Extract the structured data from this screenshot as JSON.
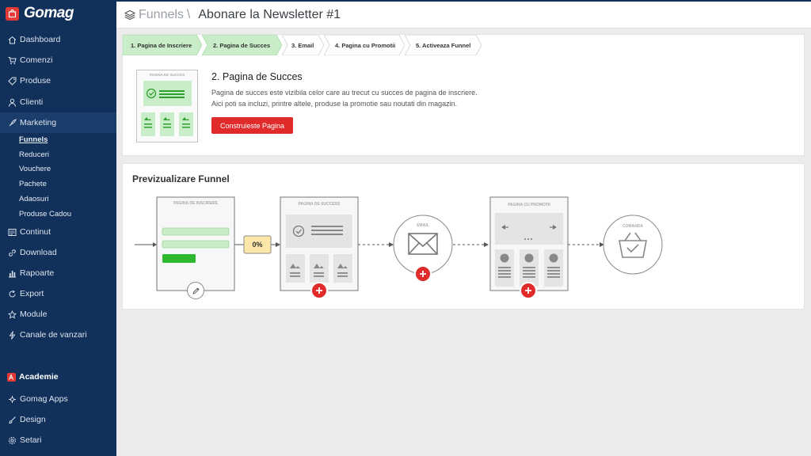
{
  "brand": {
    "name": "Gomag"
  },
  "sidebar": {
    "items": [
      {
        "label": "Dashboard",
        "icon": "home-icon"
      },
      {
        "label": "Comenzi",
        "icon": "cart-icon"
      },
      {
        "label": "Produse",
        "icon": "tag-icon"
      },
      {
        "label": "Clienti",
        "icon": "users-icon"
      },
      {
        "label": "Marketing",
        "icon": "rocket-icon"
      },
      {
        "label": "Continut",
        "icon": "content-icon"
      },
      {
        "label": "Download",
        "icon": "link-icon"
      },
      {
        "label": "Rapoarte",
        "icon": "chart-icon"
      },
      {
        "label": "Export",
        "icon": "export-icon"
      },
      {
        "label": "Module",
        "icon": "star-icon"
      },
      {
        "label": "Canale de vanzari",
        "icon": "bolt-icon"
      }
    ],
    "marketing_sub": [
      "Funnels",
      "Reduceri",
      "Vouchere",
      "Pachete",
      "Adaosuri",
      "Produse Cadou"
    ],
    "bottom": [
      {
        "label": "Academie",
        "icon": "academie-icon"
      },
      {
        "label": "Gomag Apps",
        "icon": "apps-icon"
      },
      {
        "label": "Design",
        "icon": "brush-icon"
      },
      {
        "label": "Setari",
        "icon": "gear-icon"
      }
    ]
  },
  "header": {
    "section": "Funnels",
    "separator": "\\",
    "title": "Abonare la Newsletter #1"
  },
  "steps": [
    "1. Pagina de Inscriere",
    "2. Pagina de Succes",
    "3. Email",
    "4. Pagina cu Promotii",
    "5. Activeaza Funnel"
  ],
  "step_detail": {
    "title": "2. Pagina de Succes",
    "desc_line1": "Pagina de succes este vizibila celor care au trecut cu succes de pagina de inscriere.",
    "desc_line2": "Aici poti sa incluzi, printre altele, produse la promotie sau noutati din magazin.",
    "button": "Construieste Pagina",
    "thumb_label": "PAGINA DE SUCCES"
  },
  "preview": {
    "title": "Previzualizare Funnel",
    "nodes": {
      "signup": "PAGINA DE INSCRIERE",
      "conversion": "0%",
      "success": "PAGINA DE SUCCESS",
      "email": "EMAIL",
      "promo": "PAGINA CU PROMOTII",
      "order": "COMANDA"
    }
  },
  "colors": {
    "sidebar": "#11305a",
    "accent_red": "#e12a2a",
    "step_done": "#c8edc8",
    "green_bar": "#2eb82e"
  }
}
